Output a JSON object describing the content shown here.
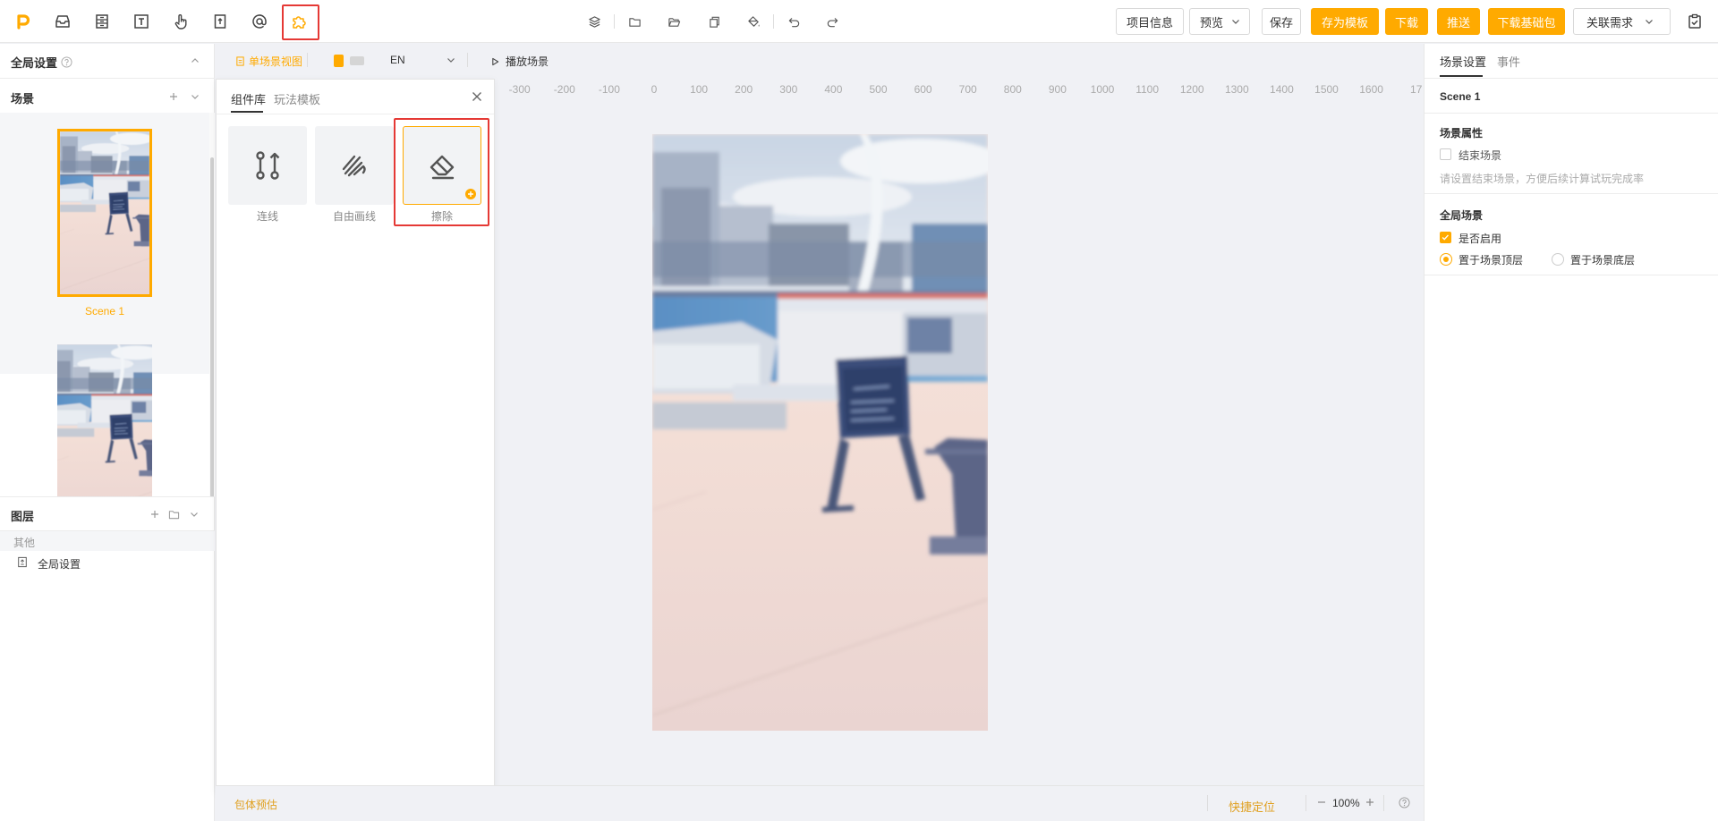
{
  "toolbar": {
    "left_icons": [
      "logo-icon",
      "inbox-icon",
      "form-icon",
      "text-icon",
      "touch-icon",
      "upload-file-icon",
      "at-sign-icon",
      "puzzle-icon"
    ],
    "mid_icons": [
      "layers-icon",
      "folder-icon",
      "folder-open-icon",
      "copy-icon",
      "paint-bucket-icon",
      "undo-icon",
      "redo-icon"
    ],
    "project_info": "项目信息",
    "preview": "预览",
    "save": "保存",
    "save_template": "存为模板",
    "download": "下载",
    "push": "推送",
    "download_base": "下载基础包",
    "link_requirement": "关联需求"
  },
  "left": {
    "global_settings": "全局设置",
    "scenes_title": "场景",
    "scene1_label": "Scene 1",
    "layers_title": "图层",
    "layer_group_other": "其他",
    "layer_item_global": "全局设置"
  },
  "canvas_bar": {
    "single_scene_view": "单场景视图",
    "language": "EN",
    "play_scene": "播放场景"
  },
  "ruler_ticks": [
    "-300",
    "-200",
    "-100",
    "0",
    "100",
    "200",
    "300",
    "400",
    "500",
    "600",
    "700",
    "800",
    "900",
    "1000",
    "1100",
    "1200",
    "1300",
    "1400",
    "1500",
    "1600",
    "17"
  ],
  "component_library": {
    "tabs": [
      "组件库",
      "玩法模板"
    ],
    "active_tab": "组件库",
    "items": [
      {
        "label": "连线",
        "icon": "connect-line-icon"
      },
      {
        "label": "自由画线",
        "icon": "freehand-draw-icon"
      },
      {
        "label": "擦除",
        "icon": "eraser-icon"
      }
    ]
  },
  "bottom_bar": {
    "size_estimate": "包体预估",
    "quick_locate": "快捷定位",
    "zoom": "100%"
  },
  "right": {
    "tabs": [
      "场景设置",
      "事件"
    ],
    "scene_name": "Scene 1",
    "scene_props_title": "场景属性",
    "end_scene_label": "结束场景",
    "end_scene_hint": "请设置结束场景，方便后续计算试玩完成率",
    "global_scene_title": "全局场景",
    "enable_label": "是否启用",
    "top_layer_label": "置于场景顶层",
    "bottom_layer_label": "置于场景底层"
  },
  "colors": {
    "accent": "#ffaa00",
    "highlight_red": "#e53935"
  }
}
